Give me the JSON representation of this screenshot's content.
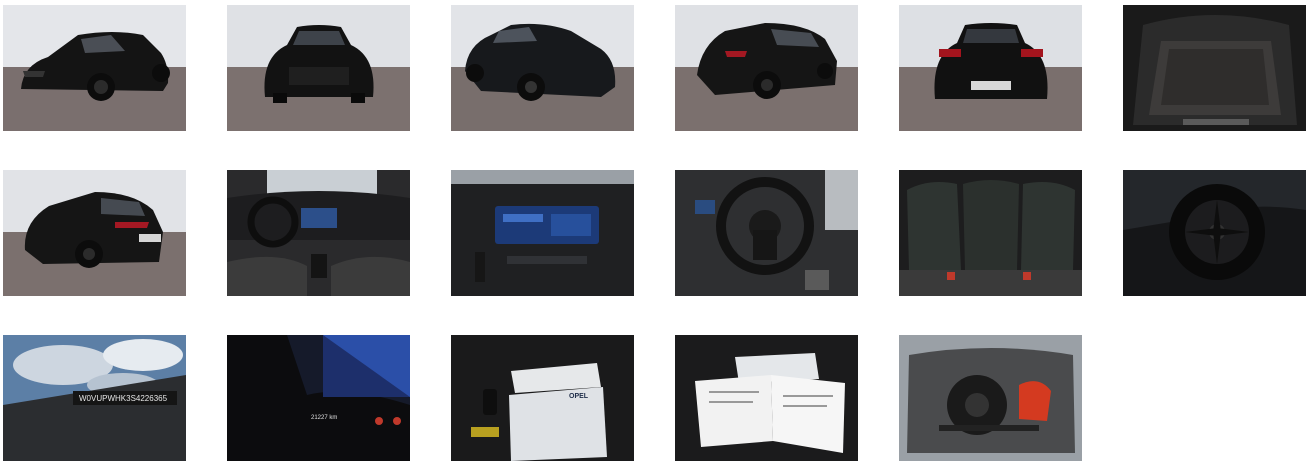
{
  "gallery": {
    "thumbnails": [
      {
        "subject": "exterior-front-left"
      },
      {
        "subject": "exterior-front"
      },
      {
        "subject": "exterior-front-right"
      },
      {
        "subject": "exterior-rear-right"
      },
      {
        "subject": "exterior-rear"
      },
      {
        "subject": "trunk-interior"
      },
      {
        "subject": "exterior-rear-left"
      },
      {
        "subject": "interior-dashboard"
      },
      {
        "subject": "infotainment-screen"
      },
      {
        "subject": "steering-wheel"
      },
      {
        "subject": "rear-seats"
      },
      {
        "subject": "wheel-closeup"
      },
      {
        "subject": "vin-windshield"
      },
      {
        "subject": "odometer"
      },
      {
        "subject": "documents-and-key"
      },
      {
        "subject": "service-papers"
      },
      {
        "subject": "spare-wheel-well"
      }
    ],
    "vin_text": "W0VUPWHK3S4226365",
    "odometer_text": "21227 km",
    "brand_text": "OPEL"
  }
}
